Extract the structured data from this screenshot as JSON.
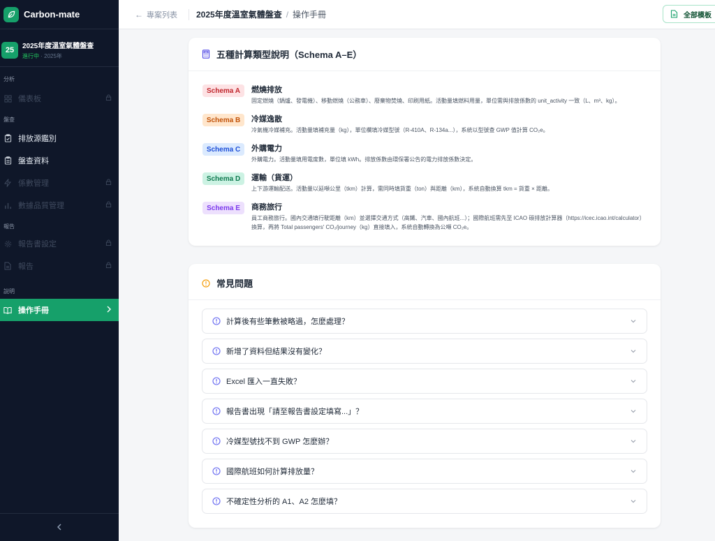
{
  "brand": {
    "name": "Carbon-mate",
    "icon": "leaf-icon",
    "color": "#16a06a"
  },
  "project": {
    "badge": "25",
    "title": "2025年度溫室氣體盤查",
    "status": "進行中",
    "year": "· 2025年"
  },
  "sidebar": {
    "sections": [
      {
        "label": "分析",
        "items": [
          {
            "label": "儀表板",
            "icon": "grid-icon",
            "state": "locked"
          }
        ]
      },
      {
        "label": "盤查",
        "items": [
          {
            "label": "排放源鑑別",
            "icon": "clipboard-check-icon",
            "state": "enabled"
          },
          {
            "label": "盤查資料",
            "icon": "clipboard-icon",
            "state": "enabled"
          },
          {
            "label": "係數管理",
            "icon": "bolt-icon",
            "state": "locked"
          },
          {
            "label": "數據品質管理",
            "icon": "bar-chart-icon",
            "state": "locked"
          }
        ]
      },
      {
        "label": "報告",
        "items": [
          {
            "label": "報告書設定",
            "icon": "gear-icon",
            "state": "locked"
          },
          {
            "label": "報告",
            "icon": "document-icon",
            "state": "locked"
          }
        ]
      },
      {
        "label": "說明",
        "items": [
          {
            "label": "操作手冊",
            "icon": "book-icon",
            "state": "active"
          }
        ]
      }
    ],
    "collapse_icon": "chevron-left-icon"
  },
  "topbar": {
    "back_label": "專案列表",
    "breadcrumb": {
      "project": "2025年度溫室氣體盤查",
      "separator": "/",
      "page": "操作手冊"
    },
    "template_button": "全部模板"
  },
  "schemas_card": {
    "title": "五種計算類型說明（Schema A–E）",
    "items": [
      {
        "tag": "Schema A",
        "name": "燃燒排放",
        "desc": "固定燃燒（鍋爐、發電機）、移動燃燒（公務車）、廢棄物焚燒、印刷用紙。活動量填燃料用量，單位需與排放係數的 unit_activity 一致（L、m³、kg）。",
        "bg": "#fde2e4",
        "fg": "#c0262d"
      },
      {
        "tag": "Schema B",
        "name": "冷媒逸散",
        "desc": "冷氣機冷媒補充。活動量填補充量（kg），單位欄填冷媒型號（R-410A、R-134a...），系統以型號查 GWP 值計算 CO₂e。",
        "bg": "#ffe6cc",
        "fg": "#c2530a"
      },
      {
        "tag": "Schema C",
        "name": "外購電力",
        "desc": "外購電力。活動量填用電度數，單位填 kWh。排放係數由環保署公告的電力排放係數決定。",
        "bg": "#dbeafe",
        "fg": "#1d4ed8"
      },
      {
        "tag": "Schema D",
        "name": "運輸（貨運）",
        "desc": "上下游運輸配送。活動量以延噸公里（tkm）計算，需同時填貨重（ton）與距離（km），系統自動換算 tkm = 貨重 × 距離。",
        "bg": "#ccf2e3",
        "fg": "#0f7a4f"
      },
      {
        "tag": "Schema E",
        "name": "商務旅行",
        "desc": "員工商務旅行。國內交通填行駛距離（km）並選擇交通方式（高鐵、汽車、國內航班...）；國際航班需先至 ICAO 碳排放計算器（https://icec.icao.int/calculator）換算，再將 Total passengers' CO₂/journey（kg）直接填入，系統自動轉換為公噸 CO₂e。",
        "bg": "#ede0fd",
        "fg": "#7c3aed"
      }
    ]
  },
  "faq_card": {
    "title": "常見問題",
    "questions": [
      "計算後有些筆數被略過，怎麼處理？",
      "新增了資料但結果沒有變化？",
      "Excel 匯入一直失敗？",
      "報告書出現「請至報告書設定填寫...」？",
      "冷媒型號找不到 GWP 怎麼辦？",
      "國際航班如何計算排放量？",
      "不確定性分析的 A1、A2 怎麼填？"
    ]
  }
}
